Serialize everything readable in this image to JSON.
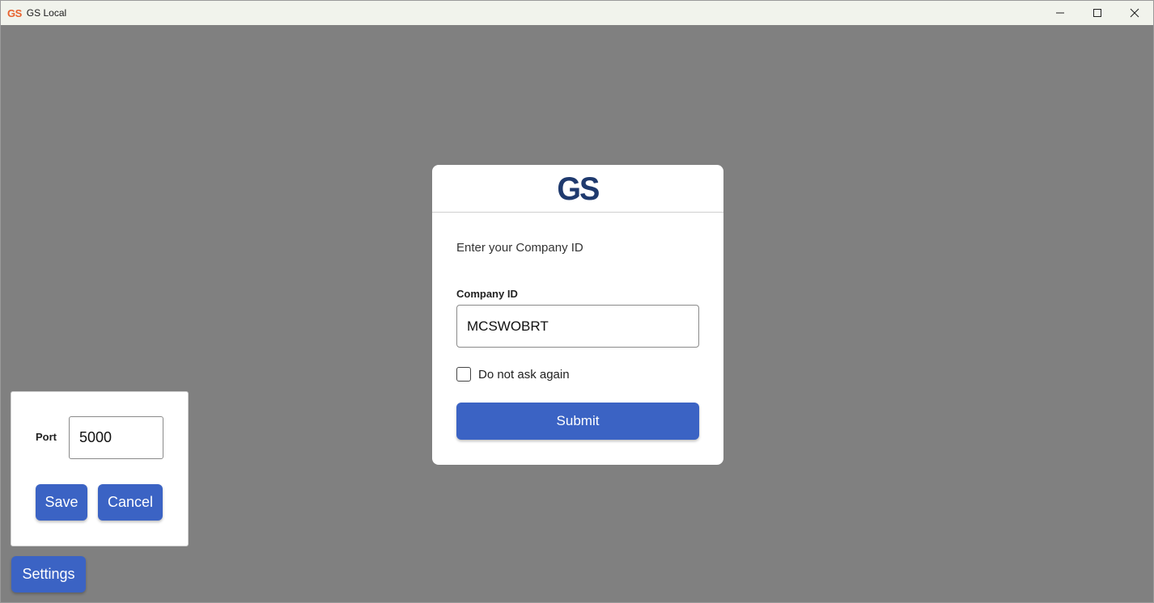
{
  "window": {
    "icon_text": "GS",
    "title": "GS Local"
  },
  "dialog": {
    "logo": "GS",
    "prompt": "Enter your Company ID",
    "company_id_label": "Company ID",
    "company_id_value": "MCSWOBRT",
    "do_not_ask_label": "Do not ask again",
    "do_not_ask_checked": false,
    "submit_label": "Submit"
  },
  "settings_panel": {
    "port_label": "Port",
    "port_value": "5000",
    "save_label": "Save",
    "cancel_label": "Cancel"
  },
  "settings_button_label": "Settings",
  "colors": {
    "accent_button": "#3b63c4",
    "logo": "#1f3a6e",
    "app_icon": "#e8612c",
    "backdrop": "#808080"
  },
  "icons": {
    "minimize": "minimize-icon",
    "maximize": "maximize-icon",
    "close": "close-icon"
  }
}
